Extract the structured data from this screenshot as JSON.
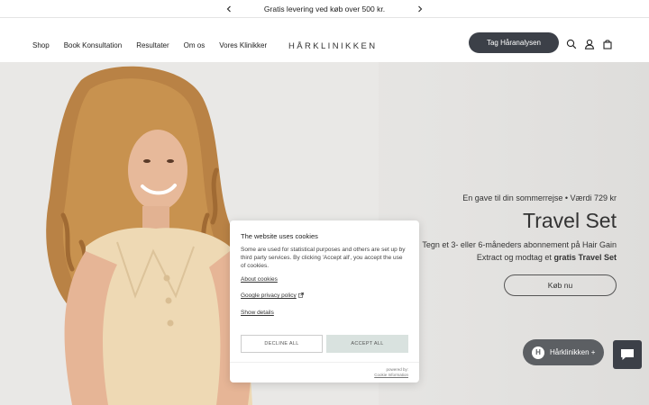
{
  "announcement": {
    "text": "Gratis levering ved køb over 500 kr.",
    "prev_icon": "chevron-left-icon",
    "next_icon": "chevron-right-icon"
  },
  "header": {
    "nav": [
      "Shop",
      "Book Konsultation",
      "Resultater",
      "Om os",
      "Vores Klinikker"
    ],
    "logo": "HÅRKLINIKKEN",
    "cta_label": "Tag Håranalysen",
    "icons": [
      "search-icon",
      "account-icon",
      "cart-icon"
    ]
  },
  "hero": {
    "subtitle": "En gave til din sommerrejse • Værdi 729 kr",
    "title": "Travel Set",
    "desc_line": "Tegn et 3- eller 6-måneders abonnement på Hair Gain Extract og modtag et",
    "desc_bold": "gratis Travel Set",
    "button_label": "Køb nu"
  },
  "cookie": {
    "title": "The website uses cookies",
    "body": "Some are used for statistical purposes and others are set up by third party services. By clicking 'Accept all', you accept the use of cookies.",
    "about_link": "About cookies",
    "privacy_link": "Google privacy policy",
    "details_link": "Show details",
    "decline_label": "DECLINE ALL",
    "accept_label": "ACCEPT ALL",
    "powered_by": "powered by:",
    "powered_name": "Cookie Information"
  },
  "chat": {
    "pill_label": "Hårklinikken +",
    "pill_logo": "H",
    "button_icon": "chat-bubble-icon"
  },
  "colors": {
    "dark": "#3c4048",
    "accept_bg": "#d9e2df",
    "hero_bg": "#e8e7e5"
  }
}
